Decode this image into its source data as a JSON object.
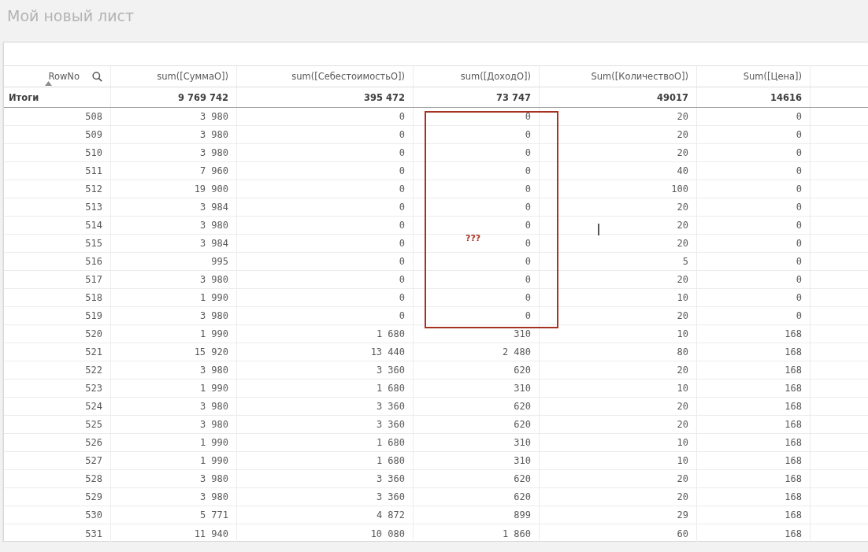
{
  "sheet": {
    "title": "Мой новый лист"
  },
  "table": {
    "columns": [
      {
        "label": "RowNo",
        "sorted": true,
        "searchable": true
      },
      {
        "label": "sum([СуммаО])",
        "sorted": false,
        "searchable": false
      },
      {
        "label": "sum([СебестоимостьО])",
        "sorted": false,
        "searchable": false
      },
      {
        "label": "sum([ДоходО])",
        "sorted": false,
        "searchable": false
      },
      {
        "label": "Sum([КоличествоО])",
        "sorted": false,
        "searchable": false
      },
      {
        "label": "Sum([Цена])",
        "sorted": false,
        "searchable": false
      }
    ],
    "totals": {
      "label": "Итоги",
      "values": [
        "9 769 742",
        "395 472",
        "73 747",
        "49017",
        "14616"
      ]
    },
    "rows": [
      [
        "508",
        "3 980",
        "0",
        "0",
        "20",
        "0"
      ],
      [
        "509",
        "3 980",
        "0",
        "0",
        "20",
        "0"
      ],
      [
        "510",
        "3 980",
        "0",
        "0",
        "20",
        "0"
      ],
      [
        "511",
        "7 960",
        "0",
        "0",
        "40",
        "0"
      ],
      [
        "512",
        "19 900",
        "0",
        "0",
        "100",
        "0"
      ],
      [
        "513",
        "3 984",
        "0",
        "0",
        "20",
        "0"
      ],
      [
        "514",
        "3 980",
        "0",
        "0",
        "20",
        "0"
      ],
      [
        "515",
        "3 984",
        "0",
        "0",
        "20",
        "0"
      ],
      [
        "516",
        "995",
        "0",
        "0",
        "5",
        "0"
      ],
      [
        "517",
        "3 980",
        "0",
        "0",
        "20",
        "0"
      ],
      [
        "518",
        "1 990",
        "0",
        "0",
        "10",
        "0"
      ],
      [
        "519",
        "3 980",
        "0",
        "0",
        "20",
        "0"
      ],
      [
        "520",
        "1 990",
        "1 680",
        "310",
        "10",
        "168"
      ],
      [
        "521",
        "15 920",
        "13 440",
        "2 480",
        "80",
        "168"
      ],
      [
        "522",
        "3 980",
        "3 360",
        "620",
        "20",
        "168"
      ],
      [
        "523",
        "1 990",
        "1 680",
        "310",
        "10",
        "168"
      ],
      [
        "524",
        "3 980",
        "3 360",
        "620",
        "20",
        "168"
      ],
      [
        "525",
        "3 980",
        "3 360",
        "620",
        "20",
        "168"
      ],
      [
        "526",
        "1 990",
        "1 680",
        "310",
        "10",
        "168"
      ],
      [
        "527",
        "1 990",
        "1 680",
        "310",
        "10",
        "168"
      ],
      [
        "528",
        "3 980",
        "3 360",
        "620",
        "20",
        "168"
      ],
      [
        "529",
        "3 980",
        "3 360",
        "620",
        "20",
        "168"
      ],
      [
        "530",
        "5 771",
        "4 872",
        "899",
        "29",
        "168"
      ],
      [
        "531",
        "11 940",
        "10 080",
        "1 860",
        "60",
        "168"
      ]
    ]
  },
  "annotation": {
    "label": "???"
  }
}
